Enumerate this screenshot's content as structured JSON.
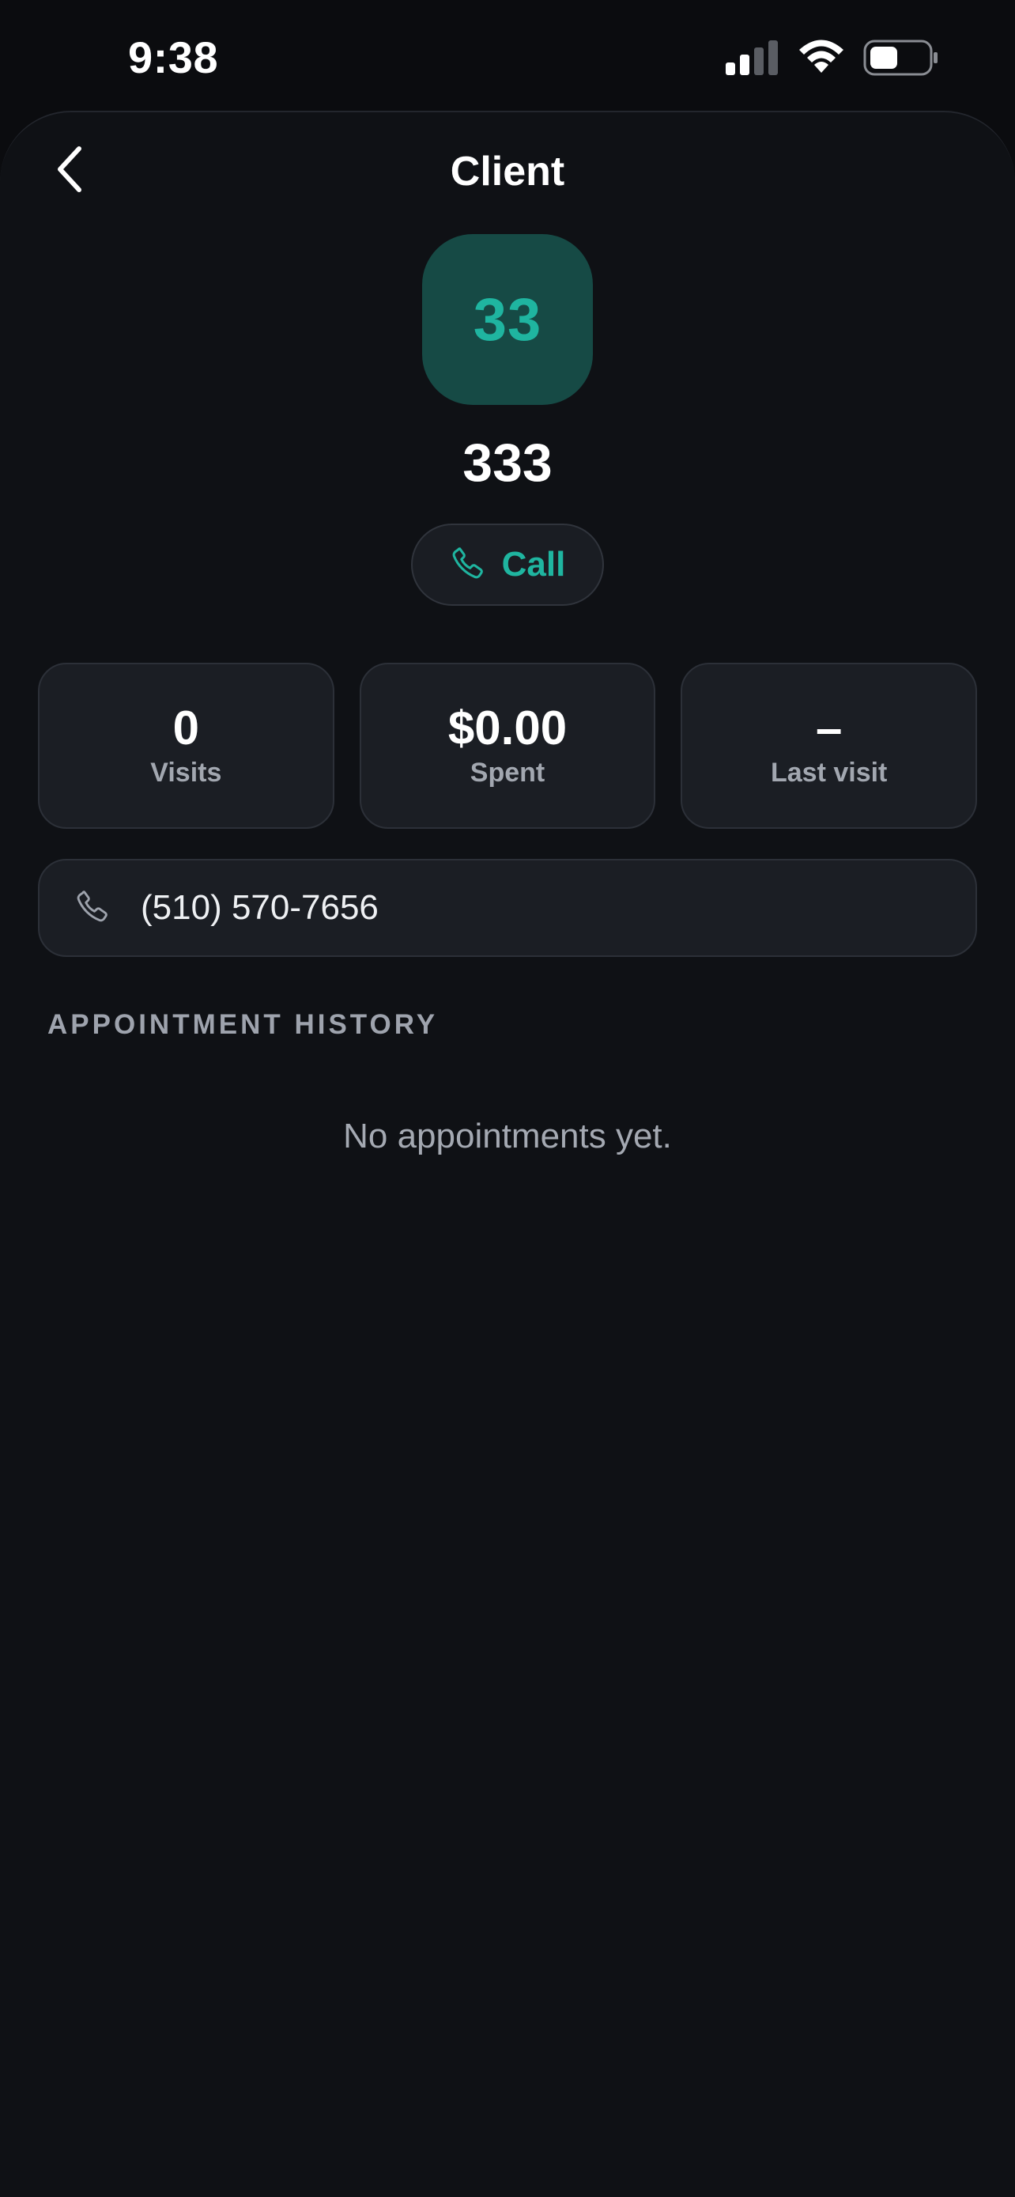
{
  "status_bar": {
    "time": "9:38"
  },
  "nav": {
    "title": "Client",
    "back_icon": "chevron-left-icon"
  },
  "client": {
    "initials": "33",
    "name": "333",
    "call_label": "Call",
    "call_icon": "phone-icon"
  },
  "stats": [
    {
      "value": "0",
      "label": "Visits"
    },
    {
      "value": "$0.00",
      "label": "Spent"
    },
    {
      "value": "–",
      "label": "Last visit"
    }
  ],
  "contact": {
    "phone": "(510) 570-7656",
    "icon": "phone-icon"
  },
  "history": {
    "title": "APPOINTMENT HISTORY",
    "empty_text": "No appointments yet."
  },
  "colors": {
    "accent": "#1fb5a0",
    "avatar_bg": "#164a45",
    "background": "#0f1115",
    "card": "#1b1e24"
  }
}
